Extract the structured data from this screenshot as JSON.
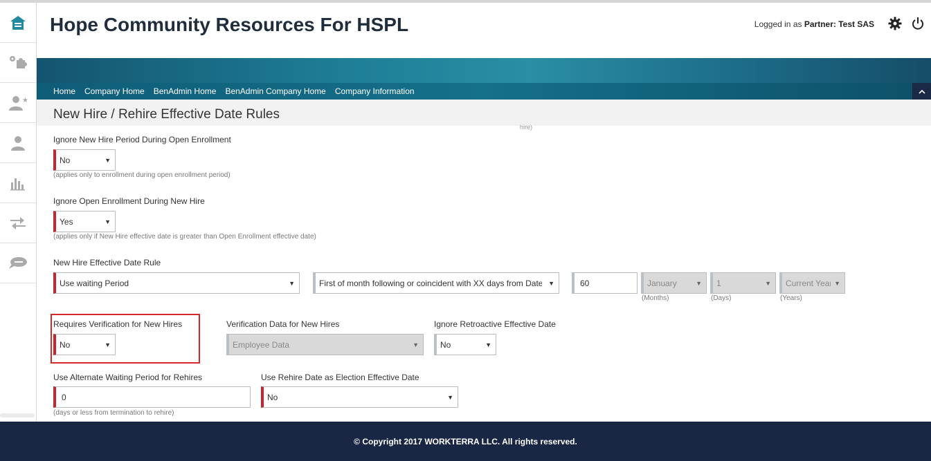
{
  "header": {
    "title": "Hope Community Resources For HSPL",
    "login_prefix": "Logged in as",
    "login_role": "Partner:",
    "login_user": "Test SAS"
  },
  "nav": {
    "links": [
      "Home",
      "Company Home",
      "BenAdmin Home",
      "BenAdmin Company Home",
      "Company Information"
    ]
  },
  "page": {
    "title": "New Hire / Rehire Effective Date Rules",
    "cut_hint": "hire)"
  },
  "form": {
    "ignore_nh_oe": {
      "label": "Ignore New Hire Period During Open Enrollment",
      "value": "No",
      "hint": "(applies only to enrollment during open enrollment period)"
    },
    "ignore_oe_nh": {
      "label": "Ignore Open Enrollment During New Hire",
      "value": "Yes",
      "hint": "(applies only if New Hire effective date is greater than Open Enrollment effective date)"
    },
    "nh_rule": {
      "label": "New Hire Effective Date Rule",
      "rule_value": "Use waiting Period",
      "rule_type_value": "First of month following or coincident with XX days from Date of Hire",
      "days_value": "60",
      "months_value": "January",
      "months_hint": "(Months)",
      "days_select_value": "1",
      "days_hint": "(Days)",
      "years_value": "Current Year",
      "years_hint": "(Years)"
    },
    "verify_nh": {
      "label": "Requires Verification for New Hires",
      "value": "No"
    },
    "verify_data": {
      "label": "Verification Data for New Hires",
      "value": "Employee Data"
    },
    "ignore_retro": {
      "label": "Ignore Retroactive Effective Date",
      "value": "No"
    },
    "alt_wait": {
      "label": "Use Alternate Waiting Period for Rehires",
      "value": "0",
      "hint": "(days or less from termination to rehire)"
    },
    "rehire_date": {
      "label": "Use Rehire Date as Election Effective Date",
      "value": "No"
    }
  },
  "footer": {
    "text": "© Copyright 2017 WORKTERRA LLC. All rights reserved."
  },
  "colors": {
    "accent_red": "#c9252c",
    "navy": "#1a2744",
    "teal": "#1e7f97"
  }
}
